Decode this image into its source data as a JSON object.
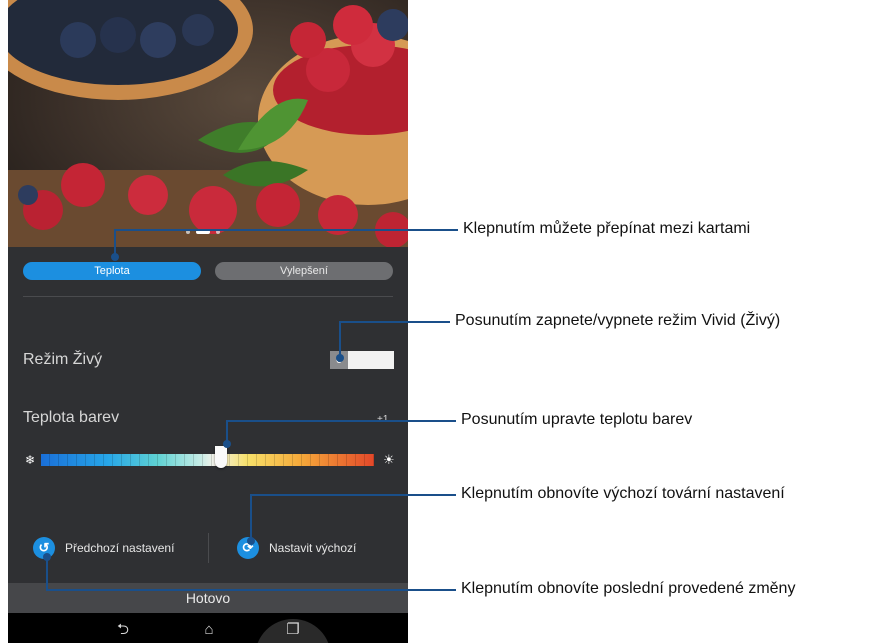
{
  "tabs": {
    "temperature": "Teplota",
    "enhancement": "Vylepšení"
  },
  "vivid": {
    "label": "Režim Živý",
    "toggle_state": "0"
  },
  "color_temp": {
    "label": "Teplota barev",
    "value": "+1",
    "position_fraction": 0.54
  },
  "actions": {
    "previous": "Předchozí nastavení",
    "set_default": "Nastavit výchozí"
  },
  "done": "Hotovo",
  "callouts": {
    "tabs": "Klepnutím můžete přepínat mezi kartami",
    "vivid": "Posunutím zapnete/vypnete režim Vivid (Živý)",
    "temperature": "Posunutím upravte teplotu barev",
    "reset_default": "Klepnutím obnovíte výchozí tovární nastavení",
    "undo": "Klepnutím obnovíte poslední provedené změny"
  },
  "colors": {
    "accent": "#1c8fe0",
    "panel": "#2f3033",
    "callout_line": "#1a4f8a"
  },
  "icons": {
    "snow": "snowflake-icon",
    "sun": "sun-icon",
    "undo": "undo-icon",
    "reset": "refresh-icon",
    "back": "back-icon",
    "home": "home-icon",
    "recent": "recent-apps-icon"
  }
}
